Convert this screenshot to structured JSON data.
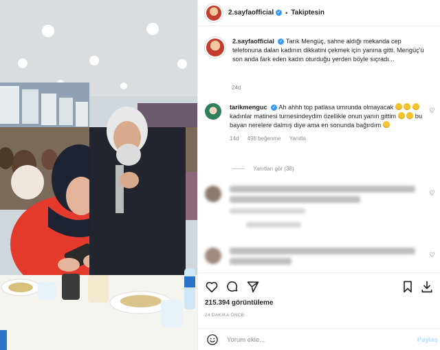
{
  "header": {
    "username": "2.sayfaofficial",
    "separator": "•",
    "follow_status": "Takiptesin"
  },
  "caption": {
    "username": "2.sayfaofficial",
    "text": "Tarık Mengüç, sahne aldığı mekanda cep telefonuna dalan kadının dikkatini çekmek için yanına gitti. Mengüç'ü son anda fark eden kadın oturduğu yerden böyle sıçradı...",
    "age": "24d"
  },
  "comments": [
    {
      "username": "tarikmenguc",
      "text_1": "Ah ahhh top patlasa umrunda olmayacak",
      "text_2": "kadınlar matinesi turnesindeydim özellikle onun yanın gittim",
      "text_3": "bu bayan nerelere dalmış diye ama en sonunda bağırdım",
      "age": "14d",
      "likes": "498 beğenme",
      "reply": "Yanıtla",
      "view_replies": "Yanıtları gör (38)"
    }
  ],
  "stats": {
    "views": "215.394 görüntüleme",
    "time": "24 DAKİKA ÖNCE"
  },
  "composer": {
    "placeholder": "Yorum ekle...",
    "post_label": "Paylaş"
  },
  "icons": [
    "heart-icon",
    "comment-icon",
    "share-icon",
    "bookmark-icon",
    "download-icon",
    "emoji-icon"
  ],
  "colors": {
    "verified": "#3897f0",
    "muted": "#8e8e8e",
    "post_disabled": "#b2dffc"
  }
}
